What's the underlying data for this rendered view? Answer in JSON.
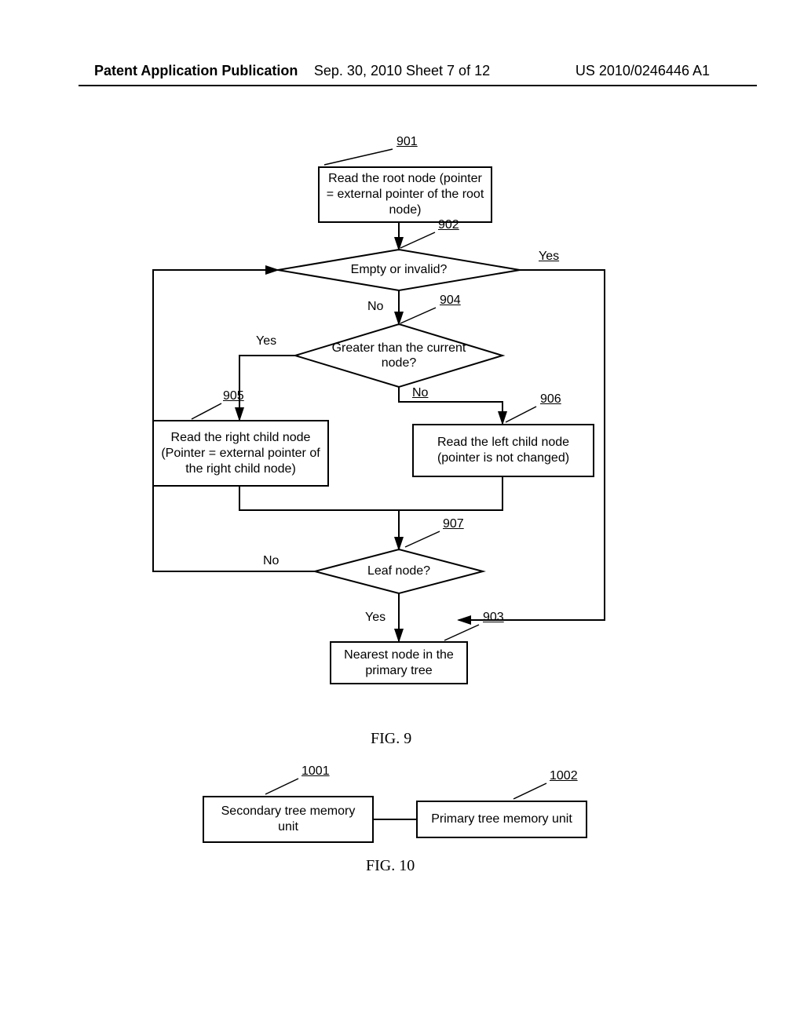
{
  "header": {
    "left": "Patent Application Publication",
    "center": "Sep. 30, 2010  Sheet 7 of 12",
    "right": "US 2010/0246446 A1"
  },
  "fig9": {
    "caption": "FIG. 9",
    "refs": {
      "n901": "901",
      "n902": "902",
      "n903": "903",
      "n904": "904",
      "n905": "905",
      "n906": "906",
      "n907": "907"
    },
    "boxes": {
      "root": "Read the root node (pointer = external pointer of the root node)",
      "right_child": "Read the right child node (Pointer = external pointer of the right child node)",
      "left_child": "Read the left child node (pointer is not changed)",
      "nearest": "Nearest node in the primary tree"
    },
    "diamonds": {
      "empty": "Empty or invalid?",
      "greater": "Greater than the current node?",
      "leaf": "Leaf node?"
    },
    "edge_labels": {
      "yes": "Yes",
      "no": "No"
    }
  },
  "fig10": {
    "caption": "FIG. 10",
    "refs": {
      "n1001": "1001",
      "n1002": "1002"
    },
    "boxes": {
      "secondary": "Secondary tree memory unit",
      "primary": "Primary tree memory unit"
    }
  },
  "chart_data": {
    "type": "flowchart",
    "nodes": [
      {
        "id": "901",
        "kind": "process",
        "text": "Read the root node (pointer = external pointer of the root node)"
      },
      {
        "id": "902",
        "kind": "decision",
        "text": "Empty or invalid?"
      },
      {
        "id": "904",
        "kind": "decision",
        "text": "Greater than the current node?"
      },
      {
        "id": "905",
        "kind": "process",
        "text": "Read the right child node (Pointer = external pointer of the right child node)"
      },
      {
        "id": "906",
        "kind": "process",
        "text": "Read the left child node (pointer is not changed)"
      },
      {
        "id": "907",
        "kind": "decision",
        "text": "Leaf node?"
      },
      {
        "id": "903",
        "kind": "process",
        "text": "Nearest node in the primary tree"
      }
    ],
    "edges": [
      {
        "from": "901",
        "to": "902"
      },
      {
        "from": "902",
        "to": "903",
        "label": "Yes"
      },
      {
        "from": "902",
        "to": "904",
        "label": "No"
      },
      {
        "from": "904",
        "to": "905",
        "label": "Yes"
      },
      {
        "from": "904",
        "to": "906",
        "label": "No"
      },
      {
        "from": "905",
        "to": "907"
      },
      {
        "from": "906",
        "to": "907"
      },
      {
        "from": "907",
        "to": "902",
        "label": "No"
      },
      {
        "from": "907",
        "to": "903",
        "label": "Yes"
      }
    ],
    "second_figure_nodes": [
      {
        "id": "1001",
        "kind": "process",
        "text": "Secondary tree memory unit"
      },
      {
        "id": "1002",
        "kind": "process",
        "text": "Primary tree memory unit"
      }
    ],
    "second_figure_edges": [
      {
        "from": "1001",
        "to": "1002"
      }
    ]
  }
}
